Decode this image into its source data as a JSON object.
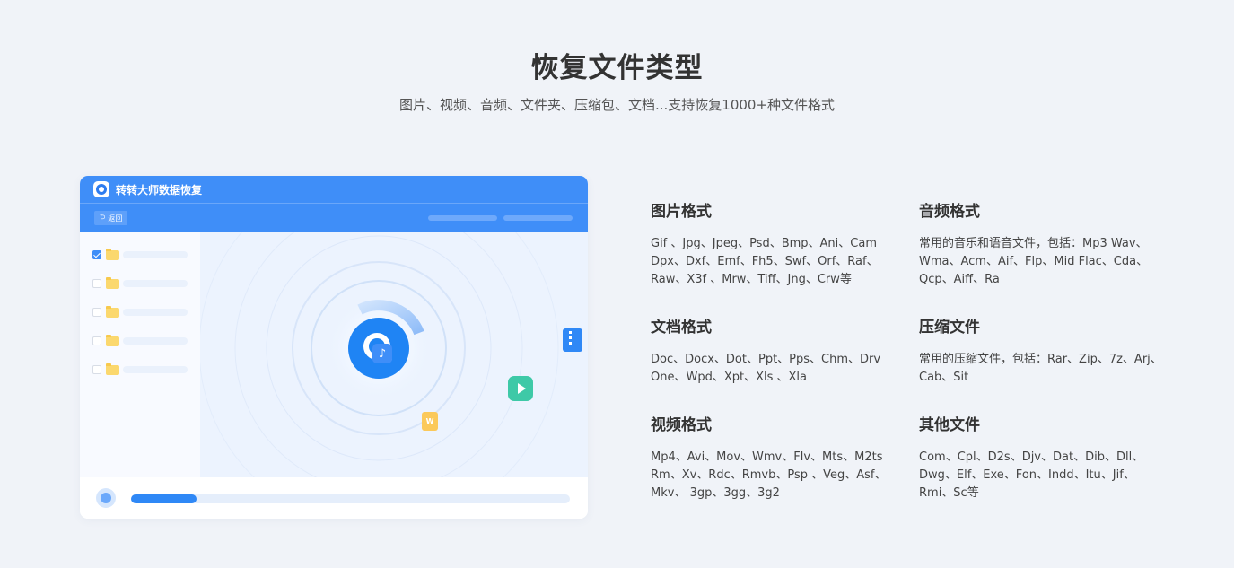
{
  "header": {
    "title": "恢复文件类型",
    "subtitle": "图片、视频、音频、文件夹、压缩包、文档...支持恢复1000+种文件格式"
  },
  "app_mock": {
    "name": "转转大师数据恢复",
    "back_label": "返回",
    "sidebar_checked": [
      true,
      false,
      false,
      false,
      false
    ],
    "progress_fraction": 0.15,
    "colors": {
      "primary": "#3f8ef8",
      "accent_green": "#3ec9a7",
      "accent_yellow": "#fbd86e"
    },
    "icons": [
      "music-note-icon",
      "zip-file-icon",
      "play-icon",
      "word-doc-icon",
      "recover-logo-icon",
      "folder-icon"
    ]
  },
  "formats": [
    {
      "title": "图片格式",
      "items": "Gif 、Jpg、Jpeg、Psd、Bmp、Ani、Cam Dpx、Dxf、Emf、Fh5、Swf、Orf、Raf、Raw、X3f 、Mrw、Tiff、Jng、Crw等"
    },
    {
      "title": "音频格式",
      "items": "常用的音乐和语音文件，包括：Mp3 Wav、Wma、Acm、Aif、Flp、Mid Flac、Cda、Qcp、Aiff、Ra"
    },
    {
      "title": "文档格式",
      "items": "Doc、Docx、Dot、Ppt、Pps、Chm、Drv One、Wpd、Xpt、Xls 、Xla"
    },
    {
      "title": "压缩文件",
      "items": "常用的压缩文件，包括：Rar、Zip、7z、Arj、Cab、Sit"
    },
    {
      "title": "视频格式",
      "items": "Mp4、Avi、Mov、Wmv、Flv、Mts、M2ts Rm、Xv、Rdc、Rmvb、Psp 、Veg、Asf、Mkv、 3gp、3gg、3g2"
    },
    {
      "title": "其他文件",
      "items": "Com、Cpl、D2s、Djv、Dat、Dib、Dll、Dwg、Elf、Exe、Fon、Indd、Itu、Jif、Rmi、Sc等"
    }
  ]
}
